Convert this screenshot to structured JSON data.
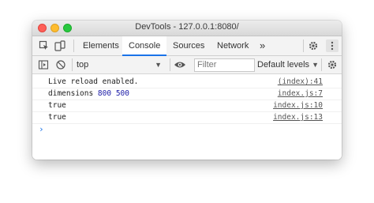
{
  "window": {
    "title": "DevTools - 127.0.0.1:8080/"
  },
  "tabs": [
    {
      "label": "Elements"
    },
    {
      "label": "Console"
    },
    {
      "label": "Sources"
    },
    {
      "label": "Network"
    }
  ],
  "tabs_overflow": "»",
  "toolbar": {
    "context": "top",
    "filter_placeholder": "Filter",
    "levels_label": "Default levels"
  },
  "console": {
    "messages": [
      {
        "text": "Live reload enabled.",
        "source": "(index):41"
      },
      {
        "text_prefix": "dimensions ",
        "values": [
          "800",
          "500"
        ],
        "source": "index.js:7"
      },
      {
        "text": "true",
        "source": "index.js:10"
      },
      {
        "text": "true",
        "source": "index.js:13"
      }
    ],
    "prompt_symbol": "›"
  },
  "colors": {
    "accent": "#1a73e8",
    "number": "#1a1aa6",
    "close": "#fe5f57",
    "minimize": "#febc2e",
    "zoom": "#28c840"
  },
  "icons": [
    "inspect-icon",
    "device-toolbar-icon",
    "settings-gear-icon",
    "kebab-menu-icon",
    "sidebar-toggle-icon",
    "clear-console-icon",
    "eye-icon",
    "settings-gear-icon"
  ]
}
